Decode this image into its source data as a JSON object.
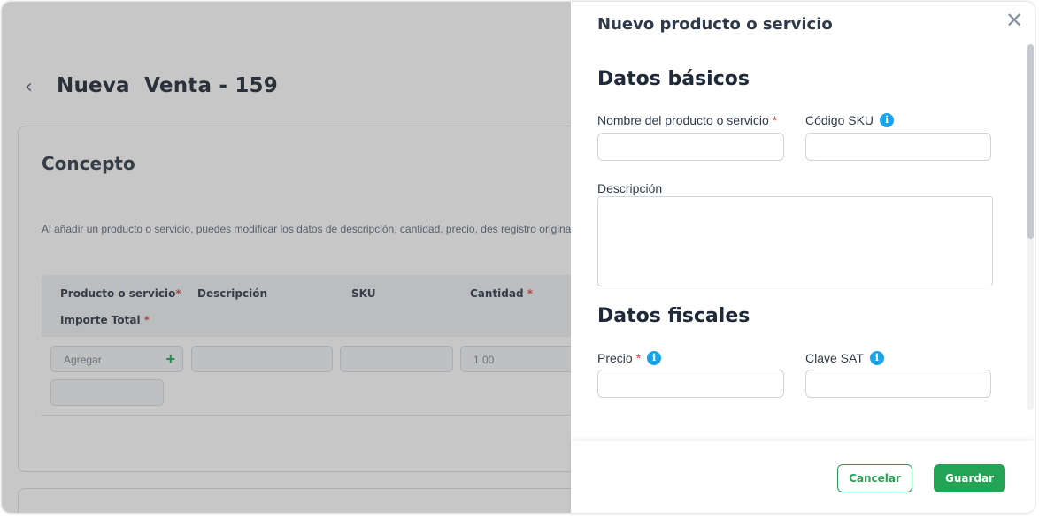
{
  "background": {
    "page_title": "Nueva  Venta - 159",
    "concept_card": {
      "title": "Concepto",
      "hint": "Al añadir un producto o servicio, puedes modificar los datos de descripción, cantidad, precio, des registro original.",
      "columns": {
        "product": "Producto o servicio",
        "description": "Descripción",
        "sku": "SKU",
        "quantity": "Cantidad",
        "total": "Importe Total"
      },
      "required_mark": "*",
      "row": {
        "product_placeholder": "Agregar",
        "quantity_value": "1.00"
      }
    }
  },
  "panel": {
    "title": "Nuevo producto o servicio",
    "basic": {
      "section_title": "Datos básicos",
      "name_label": "Nombre del producto o servicio",
      "sku_label": "Código SKU",
      "description_label": "Descripción"
    },
    "fiscal": {
      "section_title": "Datos fiscales",
      "price_label": "Precio",
      "sat_label": "Clave SAT"
    },
    "required_mark": "*",
    "info_glyph": "i",
    "close_glyph": "✕",
    "footer": {
      "cancel_label": "Cancelar",
      "save_label": "Guardar"
    }
  },
  "icons": {
    "back": "chevron-left-icon",
    "close": "close-icon",
    "info": "info-icon",
    "add": "plus-icon"
  },
  "colors": {
    "accent_green": "#23a454",
    "info_blue": "#1aa3e8",
    "required_red": "#e0483e"
  }
}
